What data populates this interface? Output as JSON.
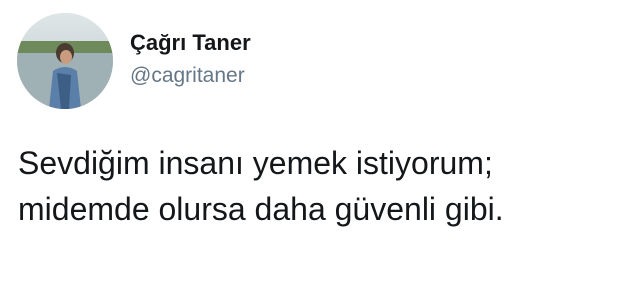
{
  "tweet": {
    "author": {
      "display_name": "Çağrı Taner",
      "handle": "@cagritaner",
      "avatar_icon": "profile-photo"
    },
    "text_lines": [
      "Sevdiğim insanı yemek istiyorum;",
      "midemde olursa daha güvenli gibi."
    ]
  },
  "colors": {
    "text_primary": "#14171a",
    "text_secondary": "#657786",
    "background": "#ffffff"
  }
}
